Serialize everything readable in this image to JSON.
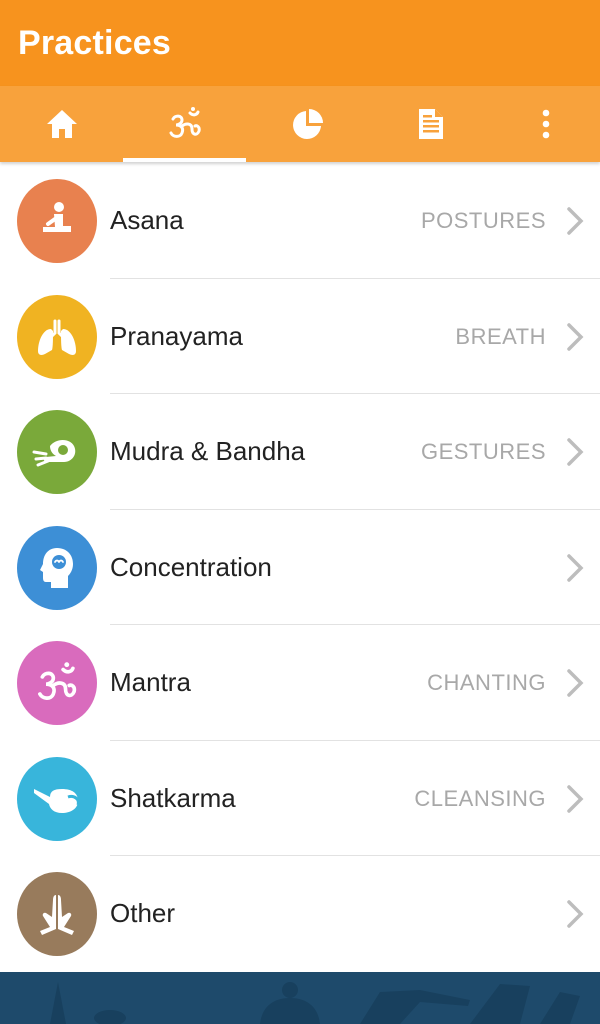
{
  "app_bar": {
    "title": "Practices"
  },
  "tabs": [
    {
      "icon": "home-icon",
      "active": false
    },
    {
      "icon": "om-icon",
      "active": true
    },
    {
      "icon": "pie-chart-icon",
      "active": false
    },
    {
      "icon": "document-icon",
      "active": false
    },
    {
      "icon": "more-vert-icon",
      "active": false
    }
  ],
  "items": [
    {
      "label": "Asana",
      "tag": "POSTURES",
      "icon": "seated-posture-icon",
      "color": "#e8814f"
    },
    {
      "label": "Pranayama",
      "tag": "BREATH",
      "icon": "lungs-icon",
      "color": "#f0b322"
    },
    {
      "label": "Mudra & Bandha",
      "tag": "GESTURES",
      "icon": "hand-gesture-icon",
      "color": "#7aa93a"
    },
    {
      "label": "Concentration",
      "tag": "",
      "icon": "head-icon",
      "color": "#3d8fd6"
    },
    {
      "label": "Mantra",
      "tag": "CHANTING",
      "icon": "om-icon",
      "color": "#d96bbd"
    },
    {
      "label": "Shatkarma",
      "tag": "CLEANSING",
      "icon": "neti-pot-icon",
      "color": "#38b5db"
    },
    {
      "label": "Other",
      "tag": "",
      "icon": "praying-hands-icon",
      "color": "#987b5c"
    }
  ],
  "colors": {
    "app_bar": "#f7931e",
    "tab_bar": "#f8a23c",
    "footer": "#1e4a6b"
  }
}
